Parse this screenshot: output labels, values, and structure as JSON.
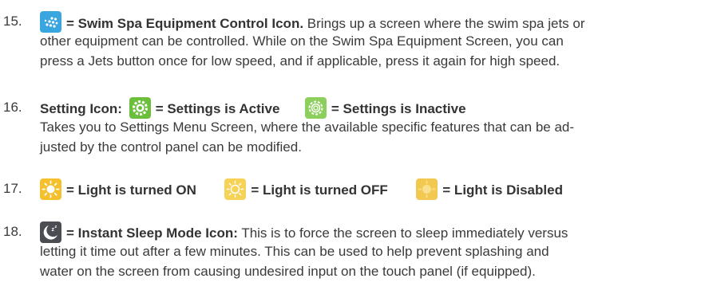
{
  "items": [
    {
      "number": "15.",
      "icon": "swim-spa-jets-icon",
      "title": "= Swim Spa Equipment Control Icon.",
      "lines": [
        "Brings up a screen where the swim spa jets or",
        "other equipment can be controlled. While on the Swim Spa Equipment Screen, you can",
        "press a Jets button once for low speed, and if applicable, press it again for high speed."
      ]
    },
    {
      "number": "16.",
      "label": "Setting Icon:",
      "active_text": "= Settings is Active",
      "inactive_text": "= Settings is Inactive",
      "lines": [
        "Takes you to Settings Menu Screen, where the available specific features that can be ad-",
        "justed by the control panel can be modified."
      ]
    },
    {
      "number": "17.",
      "on_text": "= Light is turned ON",
      "off_text": "= Light is turned OFF",
      "disabled_text": "= Light is Disabled"
    },
    {
      "number": "18.",
      "title": "= Instant Sleep Mode Icon:",
      "lines": [
        "This is to force the screen to sleep immediately versus",
        "letting it time out after a few minutes. This can be used to help prevent splashing and",
        "water on the screen from causing undesired input on the touch panel (if equipped)."
      ]
    }
  ],
  "colors": {
    "jets_blue": "#3aa6df",
    "settings_active_green": "#6cbf3b",
    "settings_inactive_green": "#8ccf5c",
    "light_on_yellow": "#f5c02e",
    "light_off_yellow": "#f6d257",
    "light_disabled_yellow": "#f3c850",
    "sleep_gray": "#4a4d52"
  }
}
